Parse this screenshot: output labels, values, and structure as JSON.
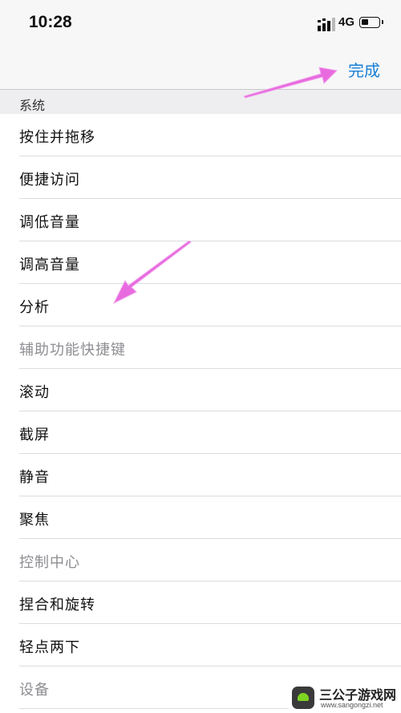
{
  "status_bar": {
    "time": "10:28",
    "network": "4G"
  },
  "nav": {
    "done_label": "完成",
    "accent_color": "#1a7fd6"
  },
  "section": {
    "title": "系统"
  },
  "items": [
    {
      "label": "按住并拖移",
      "enabled": true
    },
    {
      "label": "便捷访问",
      "enabled": true
    },
    {
      "label": "调低音量",
      "enabled": true
    },
    {
      "label": "调高音量",
      "enabled": true
    },
    {
      "label": "分析",
      "enabled": true
    },
    {
      "label": "辅助功能快捷键",
      "enabled": false
    },
    {
      "label": "滚动",
      "enabled": true
    },
    {
      "label": "截屏",
      "enabled": true
    },
    {
      "label": "静音",
      "enabled": true
    },
    {
      "label": "聚焦",
      "enabled": true
    },
    {
      "label": "控制中心",
      "enabled": false
    },
    {
      "label": "捏合和旋转",
      "enabled": true
    },
    {
      "label": "轻点两下",
      "enabled": true
    },
    {
      "label": "设备",
      "enabled": false
    }
  ],
  "watermark": {
    "name": "三公子游戏网",
    "url": "www.sangongzi.net"
  },
  "annotation_color": "#e86adf"
}
